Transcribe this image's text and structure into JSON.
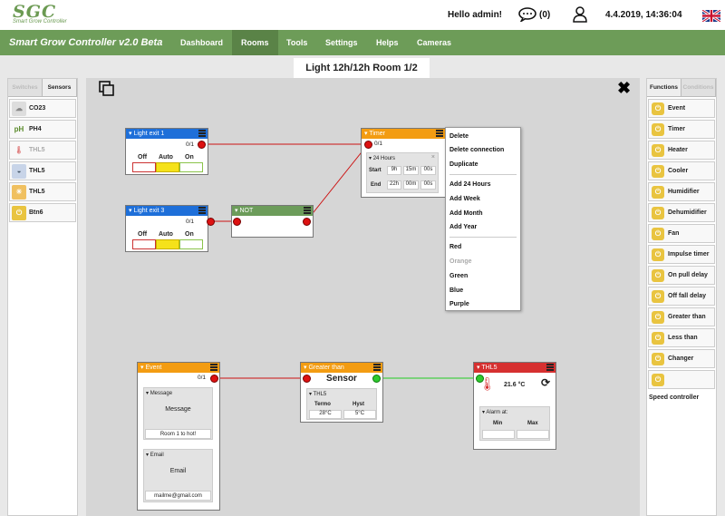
{
  "header": {
    "logo_text": "SGC",
    "logo_sub": "Smart Grow Controller",
    "greeting": "Hello admin!",
    "message_count": "(0)",
    "datetime": "4.4.2019, 14:36:04"
  },
  "nav": {
    "brand": "Smart Grow Controller v2.0 Beta",
    "items": [
      {
        "label": "Dashboard"
      },
      {
        "label": "Rooms"
      },
      {
        "label": "Tools"
      },
      {
        "label": "Settings"
      },
      {
        "label": "Helps"
      },
      {
        "label": "Cameras"
      }
    ],
    "active": "Rooms"
  },
  "room_title": "Light 12h/12h Room 1/2",
  "left_panel": {
    "tabs": [
      "Switches",
      "Sensors"
    ],
    "items": [
      {
        "label": "CO23",
        "icon": "cloud-icon"
      },
      {
        "label": "PH4",
        "icon": "ph-icon"
      },
      {
        "label": "THL5",
        "icon": "thermometer-icon"
      },
      {
        "label": "THL5",
        "icon": "gauge-icon"
      },
      {
        "label": "THL5",
        "icon": "sun-icon"
      },
      {
        "label": "Btn6",
        "icon": "power-icon"
      }
    ]
  },
  "right_panel": {
    "tabs": [
      "Functions",
      "Conditions"
    ],
    "items": [
      {
        "label": "Event"
      },
      {
        "label": "Timer"
      },
      {
        "label": "Heater"
      },
      {
        "label": "Cooler"
      },
      {
        "label": "Humidifier"
      },
      {
        "label": "Dehumidifier"
      },
      {
        "label": "Fan"
      },
      {
        "label": "Impulse timer"
      },
      {
        "label": "On pull delay"
      },
      {
        "label": "Off fall delay"
      },
      {
        "label": "Greater than"
      },
      {
        "label": "Less than"
      },
      {
        "label": "Changer"
      },
      {
        "label": ""
      }
    ],
    "footer": "Speed controller"
  },
  "nodes": {
    "light1": {
      "title": "Light exit 1",
      "out": "0/1",
      "off": "Off",
      "auto": "Auto",
      "on": "On"
    },
    "light3": {
      "title": "Light exit 3",
      "out": "0/1",
      "off": "Off",
      "auto": "Auto",
      "on": "On"
    },
    "not": {
      "title": "NOT"
    },
    "timer": {
      "title": "Timer",
      "out": "0/1",
      "section": "24 Hours",
      "start_label": "Start",
      "start_h": "9h",
      "start_m": "15m",
      "start_s": "00s",
      "end_label": "End",
      "end_h": "22h",
      "end_m": "00m",
      "end_s": "00s"
    },
    "event": {
      "title": "Event",
      "out": "0/1",
      "message_section": "Message",
      "message_label": "Message",
      "message_value": "Room 1 to hot!",
      "email_section": "Email",
      "email_label": "Email",
      "email_value": "mailme@gmail.com"
    },
    "greater": {
      "title": "Greater than",
      "sensor": "Sensor",
      "section": "THL5",
      "termo_label": "Termo",
      "hyst_label": "Hyst",
      "termo_value": "28°C",
      "hyst_value": "5°C"
    },
    "thl5": {
      "title": "THL5",
      "temp": "21.6 °C",
      "alarm": "Alarm at:",
      "min": "Min",
      "max": "Max"
    }
  },
  "context_menu": {
    "group1": [
      "Delete",
      "Delete connection",
      "Duplicate"
    ],
    "group2": [
      "Add 24 Hours",
      "Add Week",
      "Add Month",
      "Add Year"
    ],
    "group3": [
      "Red",
      "Orange",
      "Green",
      "Blue",
      "Purple"
    ],
    "disabled": "Orange"
  },
  "colors": {
    "nav_green": "#6d9c58",
    "node_blue": "#1e6fd9",
    "node_green": "#6c9c5a",
    "node_orange": "#f39c12",
    "node_red": "#d63030",
    "link_red": "#cc1111",
    "link_green": "#22cc22"
  }
}
